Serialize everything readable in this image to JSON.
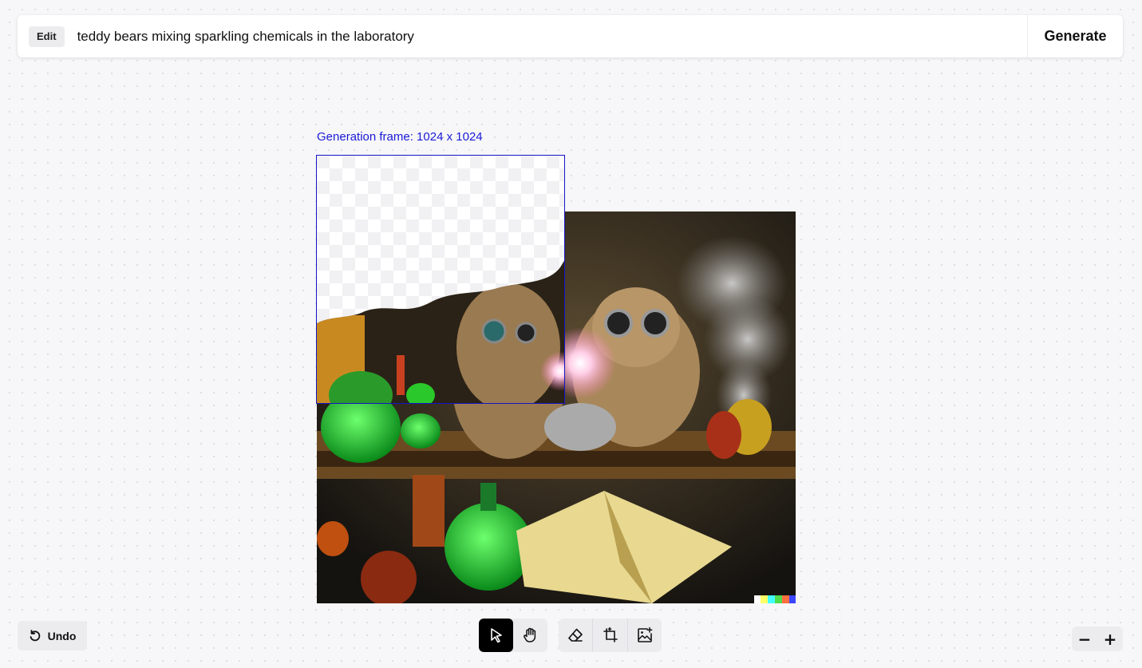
{
  "prompt_bar": {
    "edit_label": "Edit",
    "prompt_value": "teddy bears mixing sparkling chemicals in the laboratory",
    "generate_label": "Generate"
  },
  "canvas": {
    "frame_label": "Generation frame: 1024 x 1024"
  },
  "bottom": {
    "undo_label": "Undo",
    "tools": [
      {
        "name": "select-tool",
        "icon": "cursor-arrow-icon",
        "active": true
      },
      {
        "name": "pan-tool",
        "icon": "hand-icon",
        "active": false
      },
      {
        "name": "eraser-tool",
        "icon": "eraser-icon",
        "active": false
      },
      {
        "name": "add-frame-tool",
        "icon": "add-frame-icon",
        "active": false
      },
      {
        "name": "upload-image-tool",
        "icon": "add-image-icon",
        "active": false
      }
    ],
    "zoom_out_label": "−",
    "zoom_in_label": "+"
  },
  "colors": {
    "frame_accent": "#1414c8",
    "active_tool": "#000000",
    "canvas_bg": "#f7f7f9"
  }
}
